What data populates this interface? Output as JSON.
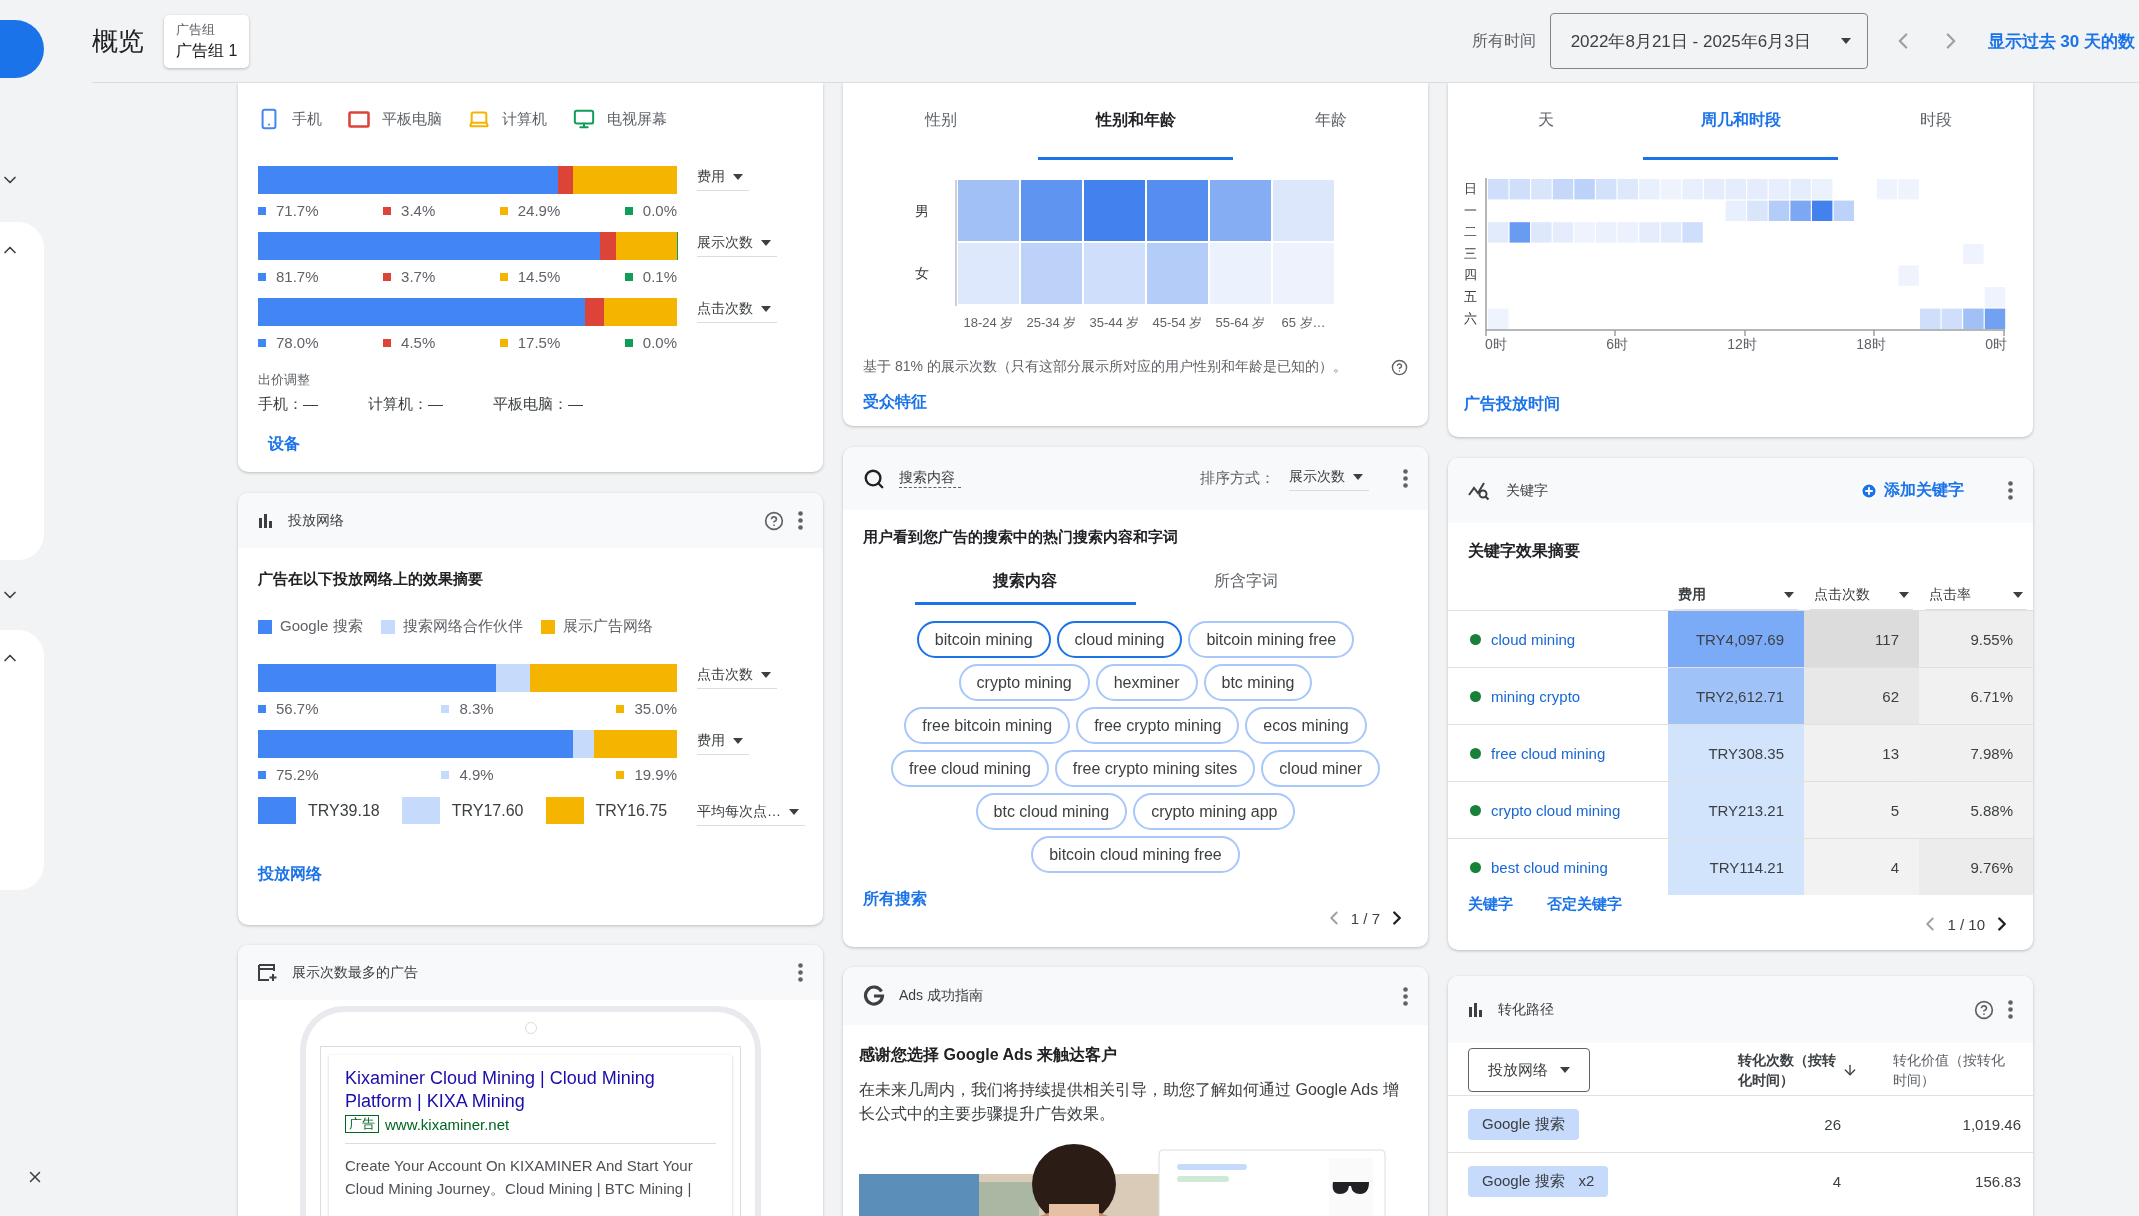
{
  "header": {
    "title": "概览",
    "ad_group_label": "广告组",
    "ad_group": "广告组 1",
    "range_label": "所有时间",
    "date_range": "2022年8月21日 - 2025年6月3日",
    "recent_link": "显示过去 30 天的数"
  },
  "devices_card": {
    "legend": [
      {
        "kind": "phone",
        "label": "手机",
        "color": "#4285f4"
      },
      {
        "kind": "tablet",
        "label": "平板电脑",
        "color": "#db4437"
      },
      {
        "kind": "computer",
        "label": "计算机",
        "color": "#f4b400"
      },
      {
        "kind": "tv",
        "label": "电视屏幕",
        "color": "#0f9d58"
      }
    ],
    "rows": [
      {
        "metric": "费用",
        "shares": [
          "71.7%",
          "3.4%",
          "24.9%",
          "0.0%"
        ]
      },
      {
        "metric": "展示次数",
        "shares": [
          "81.7%",
          "3.7%",
          "14.5%",
          "0.1%"
        ]
      },
      {
        "metric": "点击次数",
        "shares": [
          "78.0%",
          "4.5%",
          "17.5%",
          "0.0%"
        ]
      }
    ],
    "bid_title": "出价调整",
    "bids": [
      "手机：—",
      "计算机：—",
      "平板电脑：—"
    ],
    "link": "设备"
  },
  "network_card": {
    "title": "投放网络",
    "subtitle": "广告在以下投放网络上的效果摘要",
    "legend": [
      {
        "label": "Google 搜索",
        "color": "#4285f4"
      },
      {
        "label": "搜索网络合作伙伴",
        "color": "#c6dafc"
      },
      {
        "label": "展示广告网络",
        "color": "#f4b400"
      }
    ],
    "rows": [
      {
        "metric": "点击次数",
        "shares": [
          "56.7%",
          "8.3%",
          "35.0%"
        ]
      },
      {
        "metric": "费用",
        "shares": [
          "75.2%",
          "4.9%",
          "19.9%"
        ]
      }
    ],
    "avg_metric": "平均每次点…",
    "avg_values": [
      "TRY39.18",
      "TRY17.60",
      "TRY16.75"
    ],
    "link": "投放网络"
  },
  "top_ad_card": {
    "title": "展示次数最多的广告",
    "headline": "Kixaminer Cloud Mining | Cloud Mining Platform | KIXA Mining",
    "badge": "广告",
    "url": "www.kixaminer.net",
    "description": "Create Your Account On KIXAMINER And Start Your Cloud Mining Journey。Cloud Mining | BTC Mining |"
  },
  "audience_card": {
    "tabs": [
      {
        "label": "性别",
        "selected": false
      },
      {
        "label": "性别和年龄",
        "selected": true
      },
      {
        "label": "年龄",
        "selected": false
      }
    ],
    "genders": [
      "男",
      "女"
    ],
    "ages": [
      "18-24 岁",
      "25-34 岁",
      "35-44 岁",
      "45-54 岁",
      "55-64 岁",
      "65 岁…"
    ],
    "note": "基于 81% 的展示次数（只有这部分展示所对应的用户性别和年龄是已知的）。",
    "link": "受众特征"
  },
  "search_card": {
    "search_placeholder": "搜索内容",
    "sort_label": "排序方式：",
    "sort_value": "展示次数",
    "title": "用户看到您广告的搜索中的热门搜索内容和字词",
    "tabs": [
      {
        "label": "搜索内容",
        "selected": true
      },
      {
        "label": "所含字词",
        "selected": false
      }
    ],
    "term_rows": [
      [
        {
          "text": "bitcoin mining",
          "highlighted": true
        },
        {
          "text": "cloud mining",
          "highlighted": true
        },
        {
          "text": "bitcoin mining free",
          "highlighted": false
        }
      ],
      [
        {
          "text": "crypto mining",
          "highlighted": false
        },
        {
          "text": "hexminer",
          "highlighted": false
        },
        {
          "text": "btc mining",
          "highlighted": false
        }
      ],
      [
        {
          "text": "free bitcoin mining",
          "highlighted": false
        },
        {
          "text": "free crypto mining",
          "highlighted": false
        },
        {
          "text": "ecos mining",
          "highlighted": false
        }
      ],
      [
        {
          "text": "free cloud mining",
          "highlighted": false
        },
        {
          "text": "free crypto mining sites",
          "highlighted": false
        },
        {
          "text": "cloud miner",
          "highlighted": false
        }
      ],
      [
        {
          "text": "btc cloud mining",
          "highlighted": false
        },
        {
          "text": "crypto mining app",
          "highlighted": false
        }
      ],
      [
        {
          "text": "bitcoin cloud mining free",
          "highlighted": false
        }
      ]
    ],
    "link": "所有搜索",
    "pager": "1 / 7"
  },
  "guide_card": {
    "title": "Ads 成功指南",
    "heading": "感谢您选择 Google Ads 来触达客户",
    "body": "在未来几周内，我们将持续提供相关引导，助您了解如何通过 Google Ads 增长公式中的主要步骤提升广告效果。"
  },
  "time_card": {
    "tabs": [
      {
        "label": "天",
        "selected": false
      },
      {
        "label": "周几和时段",
        "selected": true
      },
      {
        "label": "时段",
        "selected": false
      }
    ],
    "days": [
      "日",
      "一",
      "二",
      "三",
      "四",
      "五",
      "六"
    ],
    "hours": [
      "0时",
      "6时",
      "12时",
      "18时",
      "0时"
    ],
    "link": "广告投放时间"
  },
  "keywords_card": {
    "title": "关键字",
    "add_button": "添加关键字",
    "subtitle": "关键字效果摘要",
    "columns": [
      {
        "label": "费用",
        "selected": true
      },
      {
        "label": "点击次数",
        "selected": false
      },
      {
        "label": "点击率",
        "selected": false
      }
    ],
    "rows": [
      {
        "keyword": "cloud mining",
        "cells": [
          {
            "text": "TRY4,097.69",
            "color": "#7baaf7"
          },
          {
            "text": "117",
            "color": "#dcdcdc"
          },
          {
            "text": "9.55%",
            "color": "#eeeeee"
          }
        ]
      },
      {
        "keyword": "mining crypto",
        "cells": [
          {
            "text": "TRY2,612.71",
            "color": "#9fc3f9"
          },
          {
            "text": "62",
            "color": "#e8e8e8"
          },
          {
            "text": "6.71%",
            "color": "#f1f1f1"
          }
        ]
      },
      {
        "keyword": "free cloud mining",
        "cells": [
          {
            "text": "TRY308.35",
            "color": "#d2e3fc"
          },
          {
            "text": "13",
            "color": "#f1f1f1"
          },
          {
            "text": "7.98%",
            "color": "#f0f0f0"
          }
        ]
      },
      {
        "keyword": "crypto cloud mining",
        "cells": [
          {
            "text": "TRY213.21",
            "color": "#d2e3fc"
          },
          {
            "text": "5",
            "color": "#f2f2f2"
          },
          {
            "text": "5.88%",
            "color": "#f2f2f2"
          }
        ]
      },
      {
        "keyword": "best cloud mining",
        "cells": [
          {
            "text": "TRY114.21",
            "color": "#d2e3fc"
          },
          {
            "text": "4",
            "color": "#f2f2f2"
          },
          {
            "text": "9.76%",
            "color": "#ececec"
          }
        ]
      }
    ],
    "links": [
      "关键字",
      "否定关键字"
    ],
    "pager": "1 / 10"
  },
  "conversion_card": {
    "title": "转化路径",
    "dropdown": "投放网络",
    "columns": [
      {
        "label": "转化次数（按转化时间）",
        "sorted": true
      },
      {
        "label": "转化价值（按转化时间）",
        "sorted": false
      }
    ],
    "rows": [
      {
        "path": "Google 搜索",
        "count": "26",
        "value": "1,019.46"
      },
      {
        "path": "Google 搜索",
        "repeat": "x2",
        "count": "4",
        "value": "156.83"
      }
    ]
  }
}
